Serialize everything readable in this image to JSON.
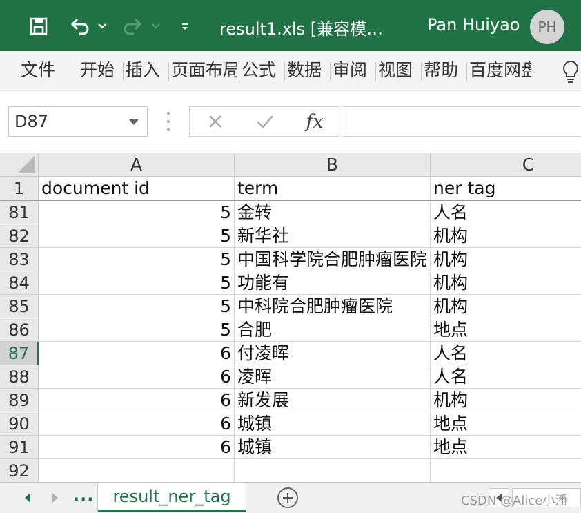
{
  "app": {
    "accent": "#217346",
    "title": "result1.xls  [兼容模…",
    "user_name": "Pan Huiyao",
    "user_initials": "PH"
  },
  "quick_access": {
    "icons": [
      "save-icon",
      "undo-icon",
      "undo-dropdown-icon",
      "redo-icon",
      "redo-dropdown-icon",
      "customize-dropdown-icon"
    ]
  },
  "menu": {
    "items": [
      "文件",
      "开始",
      "插入",
      "页面布局",
      "公式",
      "数据",
      "审阅",
      "视图",
      "帮助",
      "百度网盘"
    ],
    "tell_me_icon": "lightbulb-icon"
  },
  "formula_bar": {
    "name_box": "D87",
    "cancel_icon": "cross-icon",
    "enter_icon": "check-icon",
    "function_label": "fx",
    "formula_value": ""
  },
  "grid": {
    "columns": [
      "A",
      "B",
      "C"
    ],
    "header_row": {
      "row_number": "1",
      "cells": [
        "document id",
        "term",
        "ner tag"
      ]
    },
    "active_row": "87",
    "rows": [
      {
        "row_number": "81",
        "doc_id": "5",
        "term": "金转",
        "tag": "人名"
      },
      {
        "row_number": "82",
        "doc_id": "5",
        "term": "新华社",
        "tag": "机构"
      },
      {
        "row_number": "83",
        "doc_id": "5",
        "term": "中国科学院合肥肿瘤医院",
        "tag": "机构"
      },
      {
        "row_number": "84",
        "doc_id": "5",
        "term": "功能有",
        "tag": "机构"
      },
      {
        "row_number": "85",
        "doc_id": "5",
        "term": "中科院合肥肿瘤医院",
        "tag": "机构"
      },
      {
        "row_number": "86",
        "doc_id": "5",
        "term": "合肥",
        "tag": "地点"
      },
      {
        "row_number": "87",
        "doc_id": "6",
        "term": "付凌晖",
        "tag": "人名"
      },
      {
        "row_number": "88",
        "doc_id": "6",
        "term": "凌晖",
        "tag": "人名"
      },
      {
        "row_number": "89",
        "doc_id": "6",
        "term": "新发展",
        "tag": "机构"
      },
      {
        "row_number": "90",
        "doc_id": "6",
        "term": "城镇",
        "tag": "地点"
      },
      {
        "row_number": "91",
        "doc_id": "6",
        "term": "城镇",
        "tag": "地点"
      },
      {
        "row_number": "92",
        "doc_id": "",
        "term": "",
        "tag": ""
      }
    ]
  },
  "sheet_tabs": {
    "overflow_label": "...",
    "active_sheet": "result_ner_tag"
  },
  "watermark": "CSDN @Alice小潘"
}
